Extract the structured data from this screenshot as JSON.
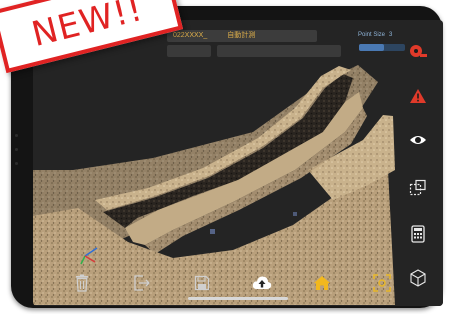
{
  "badge": {
    "text": "NEW!!"
  },
  "toolbar": {
    "project_label": "022XXXX_",
    "mode_label": "自動計測",
    "point_size_label": "Point Size",
    "point_size_value": "3",
    "point_size_level": 0.55
  },
  "side_tools": [
    {
      "icon": "tape-measure-icon"
    },
    {
      "icon": "warning-icon"
    },
    {
      "icon": "eye-icon"
    },
    {
      "icon": "section-box-icon"
    },
    {
      "icon": "calculator-icon"
    },
    {
      "icon": "wireframe-cube-icon"
    }
  ],
  "bottom_tools": [
    {
      "icon": "trash-icon"
    },
    {
      "icon": "export-icon"
    },
    {
      "icon": "save-icon"
    },
    {
      "icon": "upload-cloud-icon"
    },
    {
      "icon": "home-icon"
    },
    {
      "icon": "focus-scan-icon"
    }
  ],
  "colors": {
    "accent": "#e0b04a",
    "alert": "#e03a2a",
    "badge": "#e02323",
    "point_size": "#8fb4d8"
  }
}
